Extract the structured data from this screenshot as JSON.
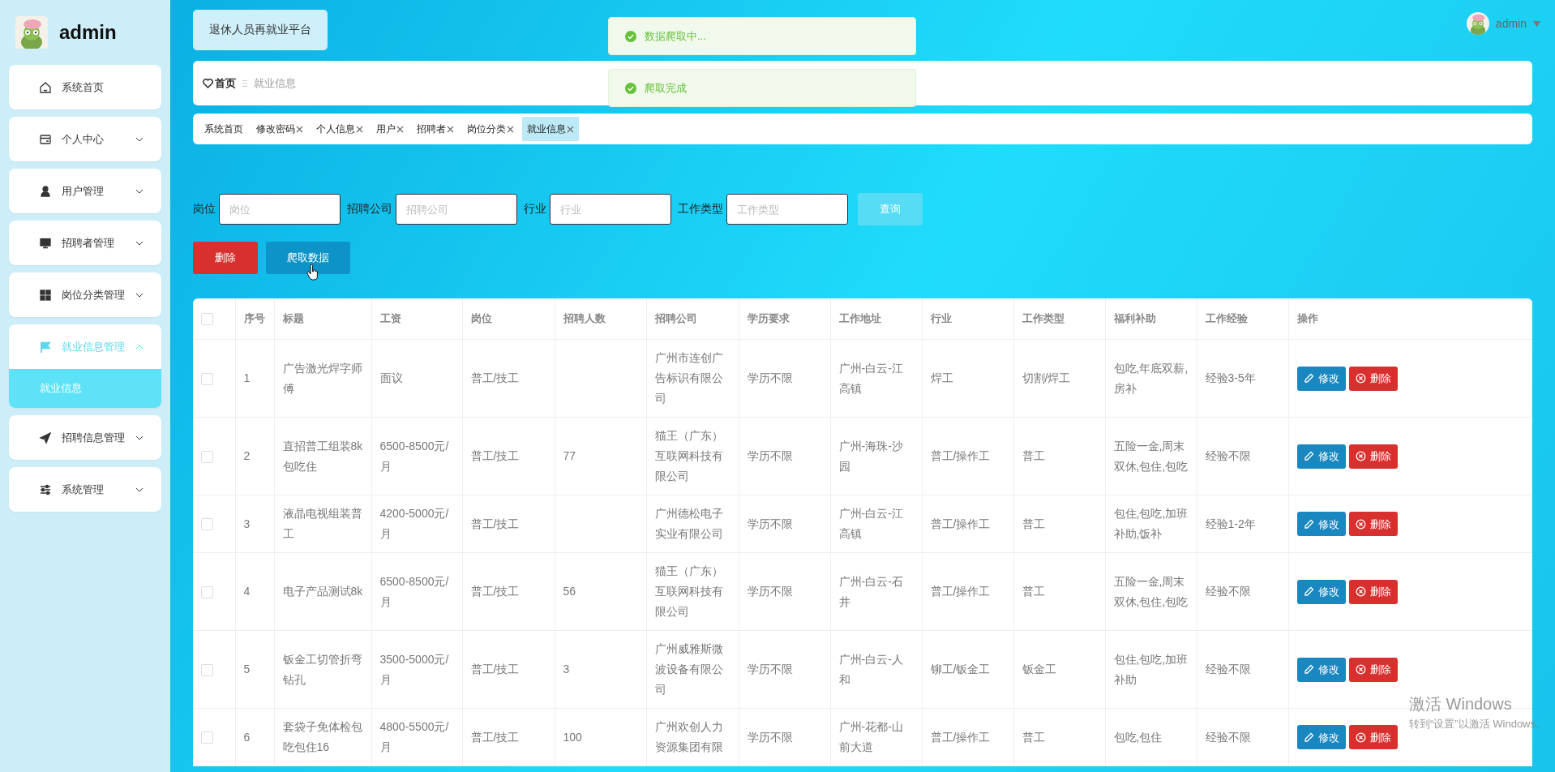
{
  "sidebar": {
    "title": "admin",
    "menu": [
      {
        "label": "系统首页",
        "kind": "link",
        "expanded": false,
        "selected": false
      },
      {
        "label": "个人中心",
        "kind": "group",
        "expanded": false,
        "selected": false
      },
      {
        "label": "用户管理",
        "kind": "group",
        "expanded": false,
        "selected": false
      },
      {
        "label": "招聘者管理",
        "kind": "group",
        "expanded": false,
        "selected": false
      },
      {
        "label": "岗位分类管理",
        "kind": "group",
        "expanded": false,
        "selected": false
      },
      {
        "label": "就业信息管理",
        "kind": "group",
        "expanded": true,
        "selected": true,
        "children": [
          {
            "label": "就业信息",
            "selected": true
          }
        ]
      },
      {
        "label": "招聘信息管理",
        "kind": "group",
        "expanded": false,
        "selected": false
      },
      {
        "label": "系统管理",
        "kind": "group",
        "expanded": false,
        "selected": false
      }
    ]
  },
  "header": {
    "platform_title": "退休人员再就业平台",
    "user": "admin"
  },
  "breadcrumb": [
    {
      "label": "首页",
      "current": false
    },
    {
      "label": "就业信息",
      "current": true
    }
  ],
  "tags": [
    {
      "label": "系统首页",
      "closable": false,
      "selected": false
    },
    {
      "label": "修改密码",
      "closable": true,
      "selected": false
    },
    {
      "label": "个人信息",
      "closable": true,
      "selected": false
    },
    {
      "label": "用户",
      "closable": true,
      "selected": false
    },
    {
      "label": "招聘者",
      "closable": true,
      "selected": false
    },
    {
      "label": "岗位分类",
      "closable": true,
      "selected": false
    },
    {
      "label": "就业信息",
      "closable": true,
      "selected": true
    }
  ],
  "toasts": [
    {
      "kind": "success",
      "text": "数据爬取中..."
    },
    {
      "kind": "success",
      "text": "爬取完成"
    }
  ],
  "filters": [
    {
      "label": "岗位",
      "placeholder": "岗位"
    },
    {
      "label": "招聘公司",
      "placeholder": "招聘公司"
    },
    {
      "label": "行业",
      "placeholder": "行业"
    },
    {
      "label": "工作类型",
      "placeholder": "工作类型"
    }
  ],
  "search_button": "查询",
  "actions": [
    {
      "kind": "delete",
      "label": "删除"
    },
    {
      "kind": "crawl",
      "label": "爬取数据"
    }
  ],
  "table": {
    "select_all_checked": false,
    "columns": [
      "序号",
      "标题",
      "工资",
      "岗位",
      "招聘人数",
      "招聘公司",
      "学历要求",
      "工作地址",
      "行业",
      "工作类型",
      "福利补助",
      "工作经验",
      "操作"
    ],
    "rows": [
      {
        "checked": false,
        "cells": [
          "1",
          "广告激光焊字师傅",
          "面议",
          "普工/技工",
          null,
          "广州市连创广告标识有限公司",
          "学历不限",
          "广州-白云-江高镇",
          "焊工",
          "切割/焊工",
          "包吃,年底双薪,房补",
          "经验3-5年"
        ],
        "actions": [
          {
            "kind": "edit",
            "label": "修改"
          },
          {
            "kind": "delete",
            "label": "删除"
          }
        ]
      },
      {
        "checked": false,
        "cells": [
          "2",
          "直招普工组装8k包吃住",
          "6500-8500元/月",
          "普工/技工",
          "77",
          "猫王（广东）互联网科技有限公司",
          "学历不限",
          "广州-海珠-沙园",
          "普工/操作工",
          "普工",
          "五险一金,周末双休,包住,包吃",
          "经验不限"
        ],
        "actions": [
          {
            "kind": "edit",
            "label": "修改"
          },
          {
            "kind": "delete",
            "label": "删除"
          }
        ]
      },
      {
        "checked": false,
        "cells": [
          "3",
          "液晶电视组装普工",
          "4200-5000元/月",
          "普工/技工",
          null,
          "广州德松电子实业有限公司",
          "学历不限",
          "广州-白云-江高镇",
          "普工/操作工",
          "普工",
          "包住,包吃,加班补助,饭补",
          "经验1-2年"
        ],
        "actions": [
          {
            "kind": "edit",
            "label": "修改"
          },
          {
            "kind": "delete",
            "label": "删除"
          }
        ]
      },
      {
        "checked": false,
        "cells": [
          "4",
          "电子产品测试8k",
          "6500-8500元/月",
          "普工/技工",
          "56",
          "猫王（广东）互联网科技有限公司",
          "学历不限",
          "广州-白云-石井",
          "普工/操作工",
          "普工",
          "五险一金,周末双休,包住,包吃",
          "经验不限"
        ],
        "actions": [
          {
            "kind": "edit",
            "label": "修改"
          },
          {
            "kind": "delete",
            "label": "删除"
          }
        ]
      },
      {
        "checked": false,
        "cells": [
          "5",
          "钣金工切管折弯钻孔",
          "3500-5000元/月",
          "普工/技工",
          "3",
          "广州威雅斯微波设备有限公司",
          "学历不限",
          "广州-白云-人和",
          "铆工/钣金工",
          "钣金工",
          "包住,包吃,加班补助",
          "经验不限"
        ],
        "actions": [
          {
            "kind": "edit",
            "label": "修改"
          },
          {
            "kind": "delete",
            "label": "删除"
          }
        ]
      },
      {
        "checked": false,
        "cells": [
          "6",
          "套袋子免体检包吃包住16",
          "4800-5500元/月",
          "普工/技工",
          "100",
          "广州欢创人力资源集团有限",
          "学历不限",
          "广州-花都-山前大道",
          "普工/操作工",
          "普工",
          "包吃,包住",
          "经验不限"
        ],
        "actions": [
          {
            "kind": "edit",
            "label": "修改"
          },
          {
            "kind": "delete",
            "label": "删除"
          }
        ]
      }
    ]
  },
  "activation_notice": {
    "title": "激活 Windows",
    "text": "转到“设置”以激活 Windows。"
  }
}
